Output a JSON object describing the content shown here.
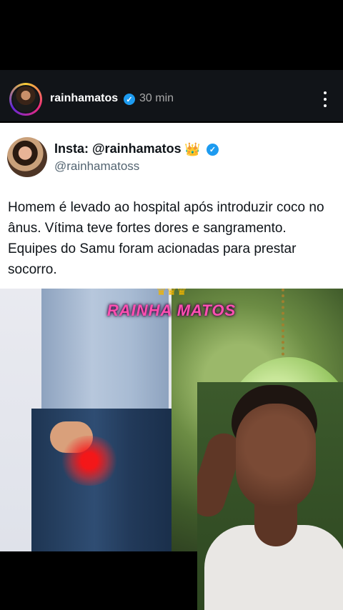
{
  "post": {
    "username": "rainhamatos",
    "time": "30 min",
    "more_icon": "more-vertical-icon"
  },
  "tweet": {
    "display_name": "Insta: @rainhamatos",
    "crown": "👑",
    "verified_icon": "verified-badge-icon",
    "handle": "@rainhamatoss",
    "text": "Homem é levado ao hospital após introduzir coco no ânus. Vítima teve fortes dores e sangramento. Equipes do Samu foram acionadas para prestar socorro."
  },
  "media": {
    "watermark": "RAINHA MATOS",
    "watermark_crown": "♛♛♛"
  },
  "colors": {
    "header_bg": "#111418",
    "verified": "#1d9bf0",
    "watermark": "#ff4fb0"
  }
}
